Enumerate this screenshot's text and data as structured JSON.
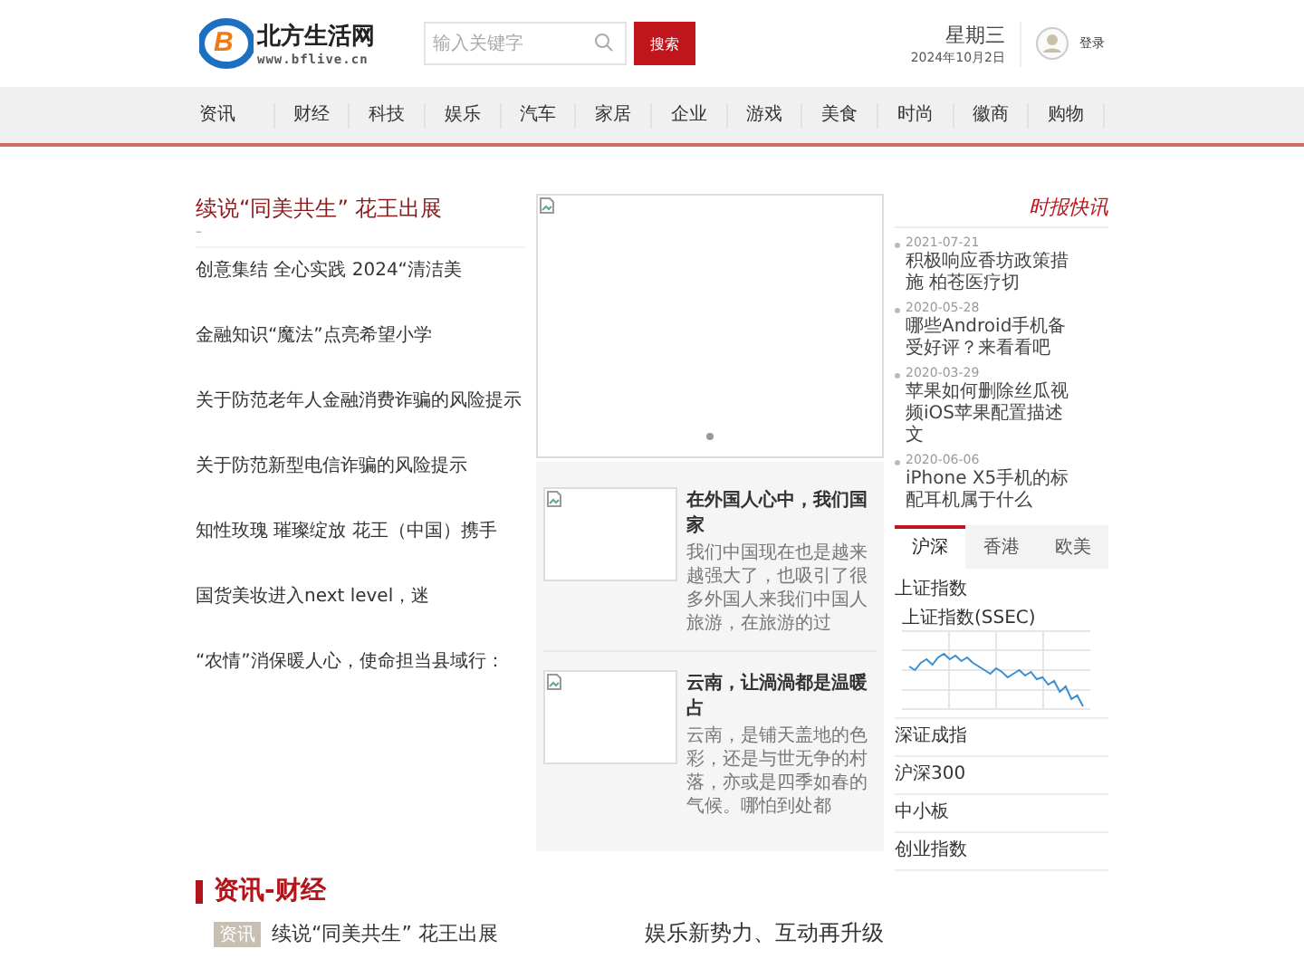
{
  "logo": {
    "letter": "B",
    "name": "北方生活网",
    "url": "www.bflive.cn"
  },
  "search": {
    "placeholder": "输入关键字",
    "button": "搜索"
  },
  "date": {
    "weekday": "星期三",
    "date": "2024年10月2日"
  },
  "login": "登录",
  "nav": [
    {
      "label": "资讯"
    },
    {
      "label": "财经"
    },
    {
      "label": "科技"
    },
    {
      "label": "娱乐"
    },
    {
      "label": "汽车"
    },
    {
      "label": "家居"
    },
    {
      "label": "企业"
    },
    {
      "label": "游戏"
    },
    {
      "label": "美食"
    },
    {
      "label": "时尚"
    },
    {
      "label": "徽商"
    },
    {
      "label": "购物"
    }
  ],
  "headline": {
    "title": "续说“同美共生” 花王出展",
    "mark": "–"
  },
  "headline_list": [
    "创意集结 全心实践 2024“清洁美",
    "金融知识“魔法”点亮希望小学",
    "关于防范老年人金融消费诈骗的风险提示",
    "关于防范新型电信诈骗的风险提示",
    "知性玫瑰 璀璨绽放 花王（中国）携手",
    "国货美妆进入next level，迷",
    "“农情”消保暖人心，使命担当县域行："
  ],
  "slider": {
    "dots": [
      {
        "selected": true
      }
    ]
  },
  "features": [
    {
      "title": "在外国人心中，我们国家",
      "desc": "我们中国现在也是越来越强大了，也吸引了很多外国人来我们中国人旅游，在旅游的过"
    },
    {
      "title": "云南，让渦渦都是温暖占",
      "desc": "云南，是铺天盖地的色彩，还是与世无争的村落，亦或是四季如春的气候。哪怕到处都"
    }
  ],
  "news": {
    "title": "时报快讯",
    "items": [
      {
        "date": "2021-07-21",
        "text": "积极响应香坊政策措施 柏苍医疗切"
      },
      {
        "date": "2020-05-28",
        "text": "哪些Android手机备受好评？来看看吧"
      },
      {
        "date": "2020-03-29",
        "text": "苹果如何删除丝瓜视频iOS苹果配置描述文"
      },
      {
        "date": "2020-06-06",
        "text": "iPhone X5手机的标配耳机属于什么"
      }
    ]
  },
  "market": {
    "tabs": [
      {
        "label": "沪深",
        "selected": true
      },
      {
        "label": "香港",
        "selected": false
      },
      {
        "label": "欧美",
        "selected": false
      }
    ],
    "index": "上证指数",
    "chart_title": "上证指数(SSEC)",
    "list": [
      "深证成指",
      "沪深300",
      "中小板",
      "创业指数"
    ]
  },
  "section": {
    "title": "资讯-财经",
    "tag": "资讯",
    "lead": "续说“同美共生” 花王出展",
    "side_title": "娱乐新势力、互动再升级"
  }
}
